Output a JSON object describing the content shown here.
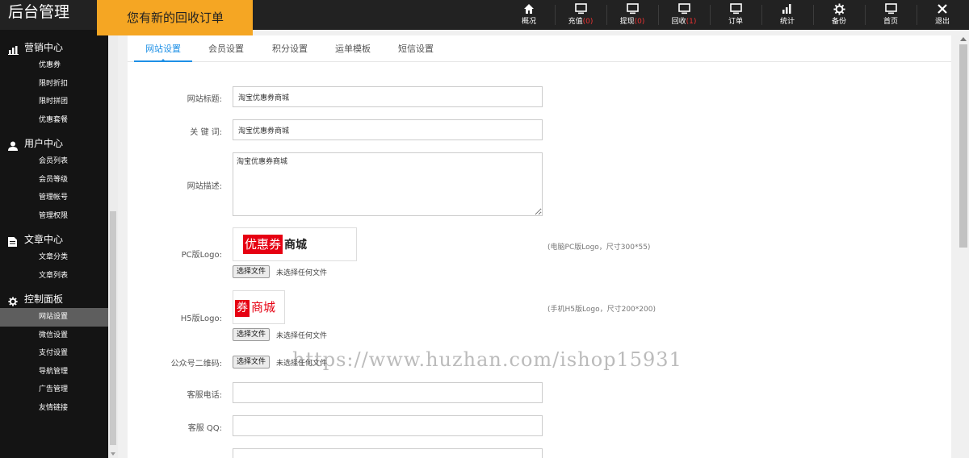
{
  "brand": "后台管理",
  "notice": "您有新的回收订单",
  "nav": [
    {
      "label": "概况",
      "icon": "home-icon"
    },
    {
      "label": "充值",
      "count": "(0)",
      "icon": "monitor-icon"
    },
    {
      "label": "提现",
      "count": "(0)",
      "icon": "monitor-icon"
    },
    {
      "label": "回收",
      "count": "(1)",
      "icon": "monitor-icon"
    },
    {
      "label": "订单",
      "icon": "monitor-icon"
    },
    {
      "label": "统计",
      "icon": "bar-chart-icon"
    },
    {
      "label": "备份",
      "icon": "gear-icon"
    },
    {
      "label": "首页",
      "icon": "monitor-icon"
    },
    {
      "label": "退出",
      "icon": "close-icon"
    }
  ],
  "sidebar": {
    "groups": [
      {
        "title": "营销中心",
        "icon": "bar-chart-icon",
        "items": [
          "优惠券",
          "限时折扣",
          "限时拼团",
          "优惠套餐"
        ]
      },
      {
        "title": "用户中心",
        "icon": "user-icon",
        "items": [
          "会员列表",
          "会员等级",
          "管理帐号",
          "管理权限"
        ]
      },
      {
        "title": "文章中心",
        "icon": "document-icon",
        "items": [
          "文章分类",
          "文章列表"
        ]
      },
      {
        "title": "控制面板",
        "icon": "gear-icon",
        "items": [
          "网站设置",
          "微信设置",
          "支付设置",
          "导航管理",
          "广告管理",
          "友情链接"
        ]
      }
    ],
    "active_item": "网站设置"
  },
  "tabs": [
    "网站设置",
    "会员设置",
    "积分设置",
    "运单模板",
    "短信设置"
  ],
  "active_tab": "网站设置",
  "form": {
    "site_title": {
      "label": "网站标题:",
      "value": "淘宝优惠券商城"
    },
    "keywords": {
      "label": "关 键 词:",
      "value": "淘宝优惠券商城"
    },
    "description": {
      "label": "网站描述:",
      "value": "淘宝优惠券商城"
    },
    "pc_logo": {
      "label": "PC版Logo:",
      "hint": "(电脑PC版Logo，尺寸300*55)",
      "logo_red": "优惠券",
      "logo_black": "商城"
    },
    "h5_logo": {
      "label": "H5版Logo:",
      "hint": "(手机H5版Logo，尺寸200*200)",
      "logo_red": "券",
      "logo_red_text": "商城"
    },
    "qrcode": {
      "label": "公众号二维码:"
    },
    "service_phone": {
      "label": "客服电话:",
      "value": ""
    },
    "service_qq": {
      "label": "客服 QQ:",
      "value": ""
    },
    "file_button": "选择文件",
    "file_none": "未选择任何文件"
  },
  "watermark": "https://www.huzhan.com/ishop15931",
  "colors": {
    "accent": "#1e90e6",
    "notice_bg": "#f5a623",
    "topbar": "#222222",
    "sidebar": "#141414",
    "logo_red": "#e60012"
  }
}
